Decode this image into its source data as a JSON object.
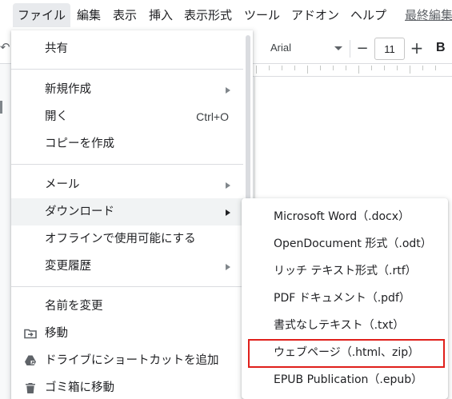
{
  "menubar": {
    "items": [
      {
        "label": "ファイル",
        "active": true
      },
      {
        "label": "編集"
      },
      {
        "label": "表示"
      },
      {
        "label": "挿入"
      },
      {
        "label": "表示形式"
      },
      {
        "label": "ツール"
      },
      {
        "label": "アドオン"
      },
      {
        "label": "ヘルプ"
      },
      {
        "label": "最終編集"
      }
    ]
  },
  "toolbar": {
    "font_name": "Arial",
    "font_size": "11",
    "minus_label": "−",
    "plus_label": "+",
    "bold_label": "B"
  },
  "file_menu": {
    "items": [
      {
        "label": "共有"
      },
      {
        "label": "新規作成",
        "submenu": true
      },
      {
        "label": "開く",
        "shortcut": "Ctrl+O"
      },
      {
        "label": "コピーを作成"
      },
      {
        "label": "メール",
        "submenu": true
      },
      {
        "label": "ダウンロード",
        "submenu": true,
        "hover": true
      },
      {
        "label": "オフラインで使用可能にする"
      },
      {
        "label": "変更履歴",
        "submenu": true
      },
      {
        "label": "名前を変更"
      },
      {
        "label": "移動",
        "icon": "folder-move-icon"
      },
      {
        "label": "ドライブにショートカットを追加",
        "icon": "drive-shortcut-icon"
      },
      {
        "label": "ゴミ箱に移動",
        "icon": "trash-icon"
      }
    ]
  },
  "download_submenu": {
    "items": [
      {
        "label": "Microsoft Word（.docx）"
      },
      {
        "label": "OpenDocument 形式（.odt）"
      },
      {
        "label": "リッチ テキスト形式（.rtf）"
      },
      {
        "label": "PDF ドキュメント（.pdf）"
      },
      {
        "label": "書式なしテキスト（.txt）"
      },
      {
        "label": "ウェブページ（.html、zip）",
        "highlighted": true
      },
      {
        "label": "EPUB Publication（.epub）"
      }
    ]
  },
  "colors": {
    "highlight_border": "#e0201b",
    "hover_bg": "#f1f3f4",
    "menu_active_bg": "#e8eaed"
  }
}
